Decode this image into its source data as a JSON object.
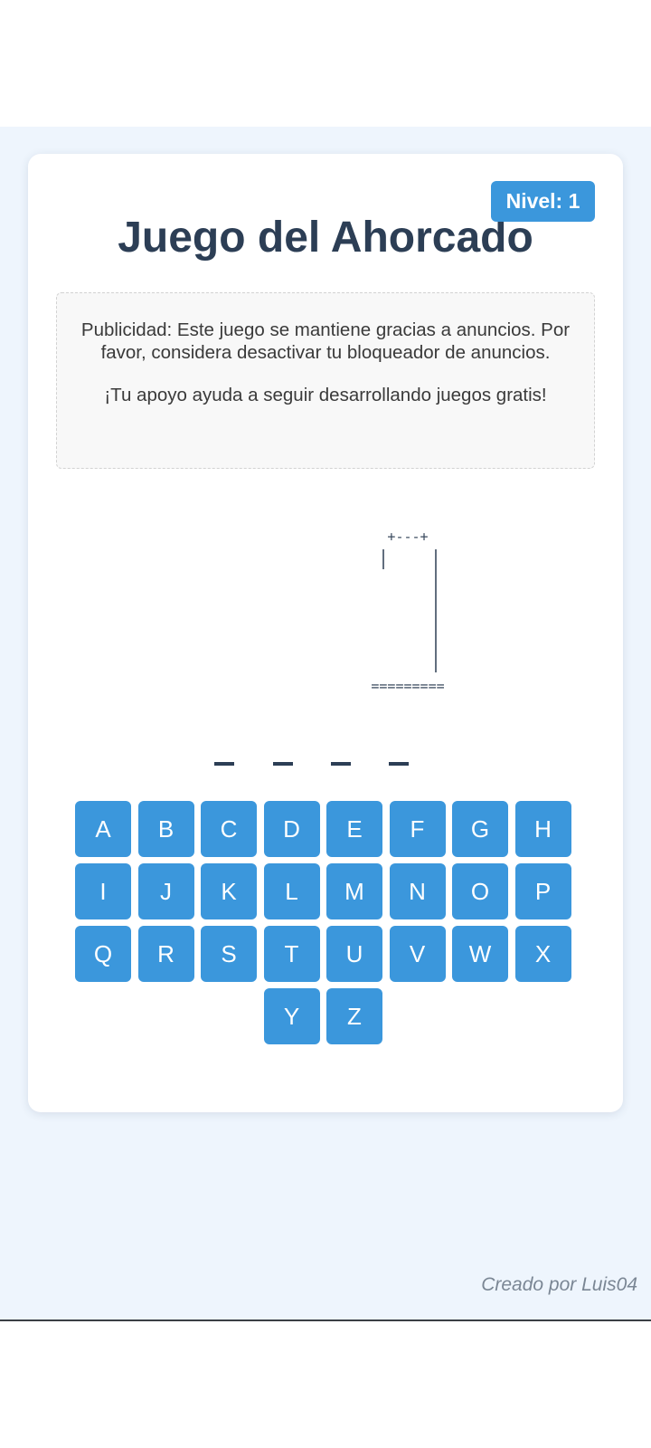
{
  "game": {
    "title": "Juego del Ahorcado",
    "level_label": "Nivel: 1"
  },
  "ad": {
    "line1": "Publicidad: Este juego se mantiene gracias a anuncios. Por favor, considera desactivar tu bloqueador de anuncios.",
    "line2": "¡Tu apoyo ayuda a seguir desarrollando juegos gratis!"
  },
  "hangman": {
    "top": "+---+",
    "base": "=========",
    "wrong_guesses": 0
  },
  "word": {
    "length": 4,
    "revealed": [
      "",
      "",
      "",
      ""
    ]
  },
  "keyboard": {
    "rows": [
      [
        "A",
        "B",
        "C",
        "D",
        "E",
        "F",
        "G",
        "H"
      ],
      [
        "I",
        "J",
        "K",
        "L",
        "M",
        "N",
        "O",
        "P"
      ],
      [
        "Q",
        "R",
        "S",
        "T",
        "U",
        "V",
        "W",
        "X"
      ],
      [
        "Y",
        "Z"
      ]
    ]
  },
  "footer": {
    "credit": "Creado por Luis04"
  },
  "colors": {
    "accent": "#3b97dc",
    "title": "#2c3e55",
    "background": "#eef5fd"
  }
}
